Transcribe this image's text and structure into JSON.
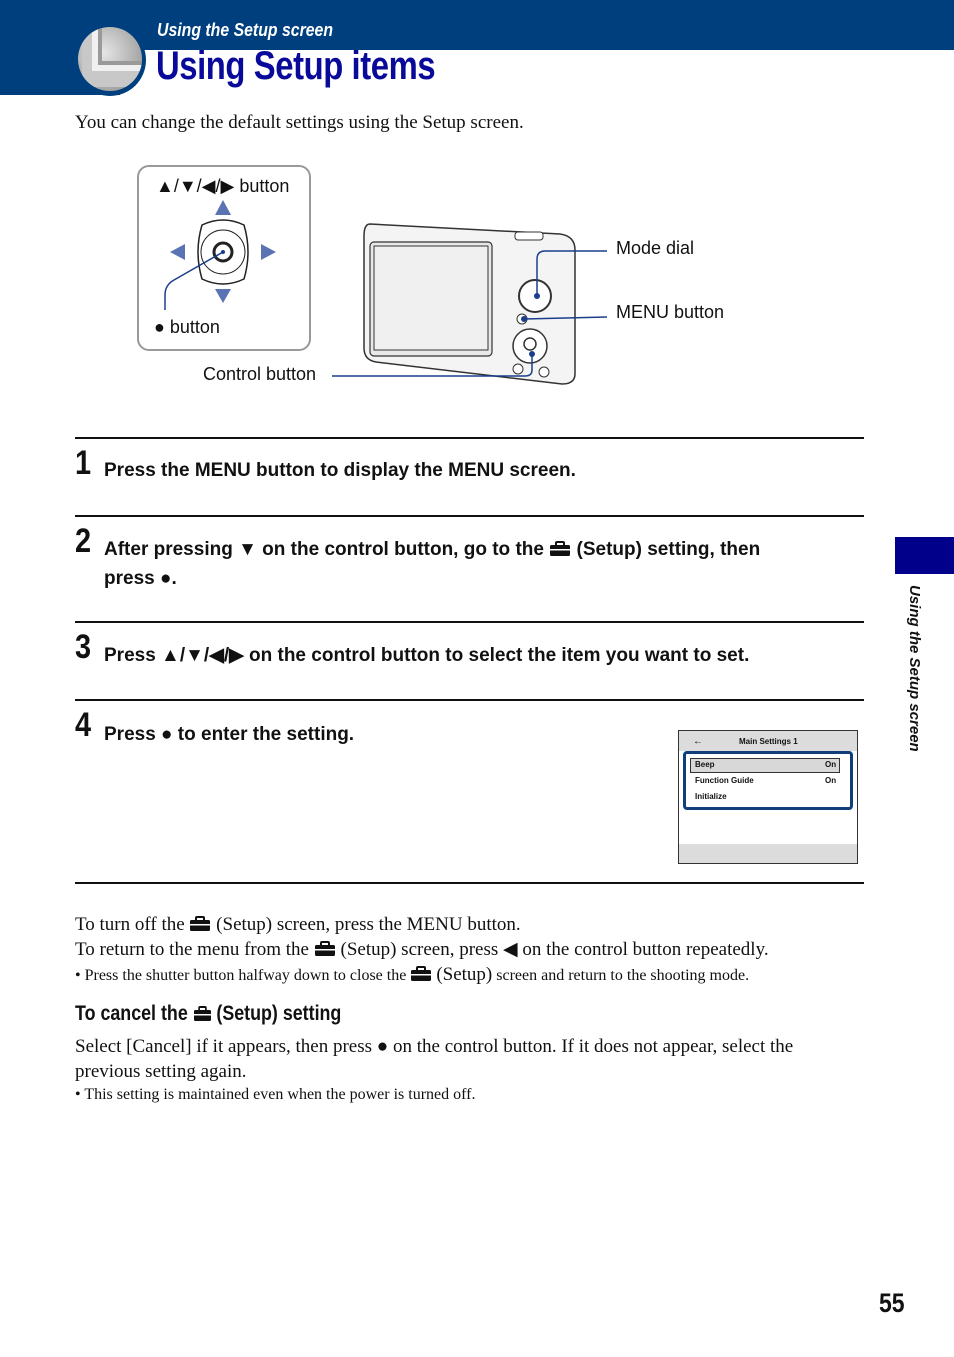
{
  "header": {
    "section": "Using the Setup screen",
    "title": "Using Setup items"
  },
  "intro": "You can change the default settings using the Setup screen.",
  "diagram": {
    "arrows_label": "▲/▼/◀/▶ button",
    "center_label": "● button",
    "control_label": "Control button",
    "mode_dial_label": "Mode dial",
    "menu_button_label": "MENU button",
    "accent_color": "#5a73b3"
  },
  "steps": [
    {
      "num": "1",
      "text": "Press the MENU button to display the MENU screen."
    },
    {
      "num": "2",
      "text_a": "After pressing ▼ on the control button, go to the",
      "text_b": "(Setup) setting, then",
      "text_c": "press ●."
    },
    {
      "num": "3",
      "text": "Press ▲/▼/◀/▶ on the control button to select the item you want to set."
    },
    {
      "num": "4",
      "text": "Press ● to enter the setting."
    }
  ],
  "lcd": {
    "back_icon": "←",
    "title": "Main Settings 1",
    "items": [
      {
        "label": "Beep",
        "value": "On",
        "selected": true
      },
      {
        "label": "Function Guide",
        "value": "On",
        "selected": false
      },
      {
        "label": "Initialize",
        "value": "",
        "selected": false
      }
    ]
  },
  "after": {
    "line1_a": "To turn off the",
    "line1_b": "(Setup) screen, press the MENU button.",
    "line2_a": "To return to the menu from the",
    "line2_b": "(Setup) screen, press ◀ on the control button repeatedly.",
    "note_a": "• Press the shutter button halfway down to close the",
    "note_b": "(Setup)",
    "note_c": "screen and return to the shooting mode."
  },
  "cancel": {
    "heading_a": "To cancel the",
    "heading_b": "(Setup) setting",
    "body": "Select [Cancel] if it appears, then press ● on the control button. If it does not appear, select the previous setting again.",
    "note": "• This setting is maintained even when the power is turned off."
  },
  "side_tab": {
    "label": "Using the Setup screen",
    "color": "#00008b"
  },
  "page_number": "55"
}
